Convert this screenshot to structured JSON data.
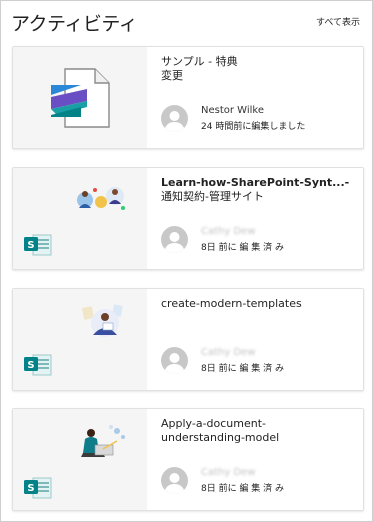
{
  "header": {
    "title": "アクティビティ",
    "see_all": "すべて表示"
  },
  "cards": [
    {
      "title_line1": "サンプル - 特典",
      "title_line2": "変更",
      "editor": "Nestor Wilke",
      "time": "24 時間前に編集しました",
      "thumbnail_icon": "stream-file-icon"
    },
    {
      "title_line1": "Learn-how-SharePoint-Synt...-",
      "title_line2": "通知契約-管理サイト",
      "editor": "Cathy Dew",
      "time": "8日 前に 編 集 済 み",
      "thumbnail_icon": "sharepoint-icon"
    },
    {
      "title_line1": "create-modern-templates",
      "title_line2": "",
      "editor": "Cathy Dew",
      "time": "8日 前に 編 集 済 み",
      "thumbnail_icon": "sharepoint-icon"
    },
    {
      "title_line1": "Apply-a-document-",
      "title_line2": "understanding-model",
      "editor": "Cathy Dew",
      "time": "8日 前に 編 集 済 み",
      "thumbnail_icon": "sharepoint-icon"
    }
  ],
  "colors": {
    "sharepoint_green": "#038387",
    "card_left_bg": "#f5f5f5",
    "avatar_gray": "#c8c8c8"
  }
}
